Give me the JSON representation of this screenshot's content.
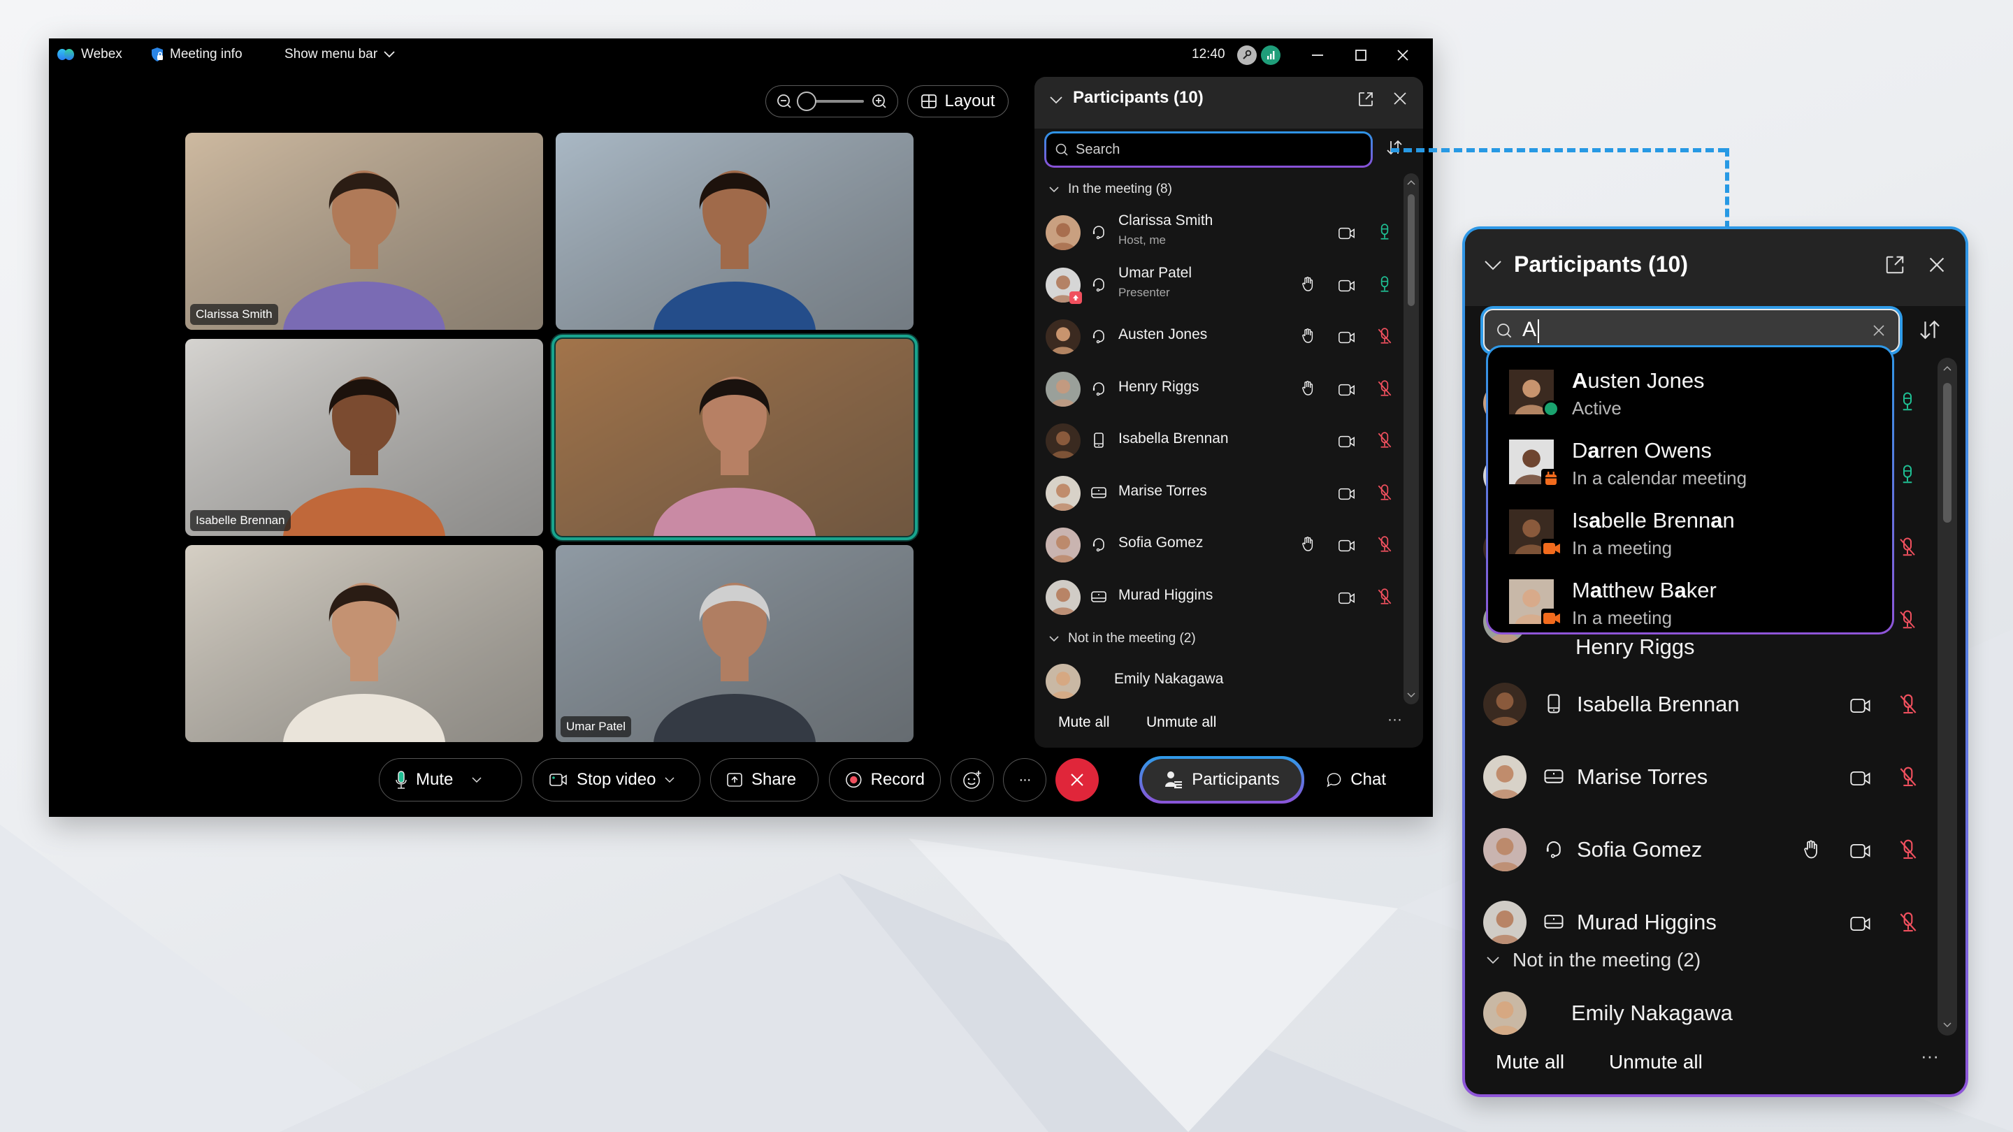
{
  "titlebar": {
    "app_name": "Webex",
    "meeting_info": "Meeting info",
    "show_menu_bar": "Show menu bar",
    "time": "12:40",
    "icons": [
      "webex-logo-icon",
      "shield-lock-icon",
      "chevron-down-icon",
      "key-icon",
      "signal-icon",
      "minimize-icon",
      "maximize-icon",
      "close-icon"
    ]
  },
  "view_controls": {
    "zoom_level": 0,
    "layout_label": "Layout"
  },
  "video_tiles": [
    {
      "name": "Clarissa Smith",
      "show_label": true,
      "active": false,
      "bg": "#cdb9a0",
      "shirt": "#7a6bb4",
      "skin": "#b07a58",
      "hair": "#2b1d14"
    },
    {
      "name": "",
      "show_label": false,
      "active": false,
      "bg": "#a9b8c4",
      "shirt": "#244d8a",
      "skin": "#a06a4a",
      "hair": "#1d120c"
    },
    {
      "name": "Isabelle Brennan",
      "show_label": true,
      "active": false,
      "bg": "#d5d3d0",
      "shirt": "#c0683a",
      "skin": "#7b4b30",
      "hair": "#1c120c"
    },
    {
      "name": "",
      "show_label": false,
      "active": true,
      "bg": "#a3744a",
      "shirt": "#c98aa4",
      "skin": "#b78064",
      "hair": "#1a120e"
    },
    {
      "name": "",
      "show_label": false,
      "active": false,
      "bg": "#d6cfc4",
      "shirt": "#eae4da",
      "skin": "#c49272",
      "hair": "#2a1c14"
    },
    {
      "name": "Umar Patel",
      "show_label": true,
      "active": false,
      "bg": "#8f9aa4",
      "shirt": "#343a44",
      "skin": "#b07e62",
      "hair": "#cfcfcf"
    }
  ],
  "toolbar": {
    "mute": "Mute",
    "stop_video": "Stop video",
    "share": "Share",
    "record": "Record",
    "reactions_icon": "emoji-add-icon",
    "more": "···",
    "end_icon": "close-icon",
    "participants": "Participants",
    "chat": "Chat"
  },
  "participants_panel": {
    "title": "Participants (10)",
    "search_placeholder": "Search",
    "in_meeting_header": "In the meeting (8)",
    "not_in_meeting_header": "Not in the meeting (2)",
    "in_meeting": [
      {
        "name": "Clarissa Smith",
        "sub": "Host, me",
        "device": "headset",
        "hand": false,
        "mic": "on",
        "presenter": false,
        "avatar_bg": "#c9a080",
        "avatar_skin": "#a86e4e"
      },
      {
        "name": "Umar Patel",
        "sub": "Presenter",
        "device": "headset",
        "hand": true,
        "mic": "on",
        "presenter": true,
        "avatar_bg": "#d6d6d6",
        "avatar_skin": "#b48266"
      },
      {
        "name": "Austen Jones",
        "sub": "",
        "device": "headset",
        "hand": true,
        "mic": "muted",
        "presenter": false,
        "avatar_bg": "#3b2a20",
        "avatar_skin": "#c8946e"
      },
      {
        "name": "Henry Riggs",
        "sub": "",
        "device": "headset",
        "hand": true,
        "mic": "muted",
        "presenter": false,
        "avatar_bg": "#9aa09a",
        "avatar_skin": "#c29a80"
      },
      {
        "name": "Isabella Brennan",
        "sub": "",
        "device": "phone",
        "hand": false,
        "mic": "muted",
        "presenter": false,
        "avatar_bg": "#3a2a20",
        "avatar_skin": "#8a5a3c"
      },
      {
        "name": "Marise Torres",
        "sub": "",
        "device": "room",
        "hand": false,
        "mic": "muted",
        "presenter": false,
        "avatar_bg": "#d8d2c8",
        "avatar_skin": "#c08c6c"
      },
      {
        "name": "Sofia Gomez",
        "sub": "",
        "device": "headset",
        "hand": true,
        "mic": "muted",
        "presenter": false,
        "avatar_bg": "#c9b4b0",
        "avatar_skin": "#bc8a6c"
      },
      {
        "name": "Murad Higgins",
        "sub": "",
        "device": "room",
        "hand": false,
        "mic": "muted",
        "presenter": false,
        "avatar_bg": "#d0ccc6",
        "avatar_skin": "#b88466"
      }
    ],
    "not_in_meeting": [
      {
        "name": "Emily Nakagawa",
        "avatar_bg": "#c9b8a4",
        "avatar_skin": "#d6a882"
      }
    ],
    "mute_all": "Mute all",
    "unmute_all": "Unmute all",
    "more": "···"
  },
  "callout_panel": {
    "title": "Participants (10)",
    "search_value": "A",
    "suggestions": [
      {
        "parts": [
          [
            "A",
            true
          ],
          [
            "usten Jones",
            false
          ]
        ],
        "status": "Active",
        "status_type": "active",
        "avatar_bg": "#3b2a20",
        "avatar_skin": "#c8946e"
      },
      {
        "parts": [
          [
            "D",
            false
          ],
          [
            "a",
            true
          ],
          [
            "rren Owens",
            false
          ]
        ],
        "status": "In a calendar meeting",
        "status_type": "calendar",
        "avatar_bg": "#e0e0e0",
        "avatar_skin": "#6e4530"
      },
      {
        "parts": [
          [
            "Is",
            false
          ],
          [
            "a",
            true
          ],
          [
            "belle Brenn",
            false
          ],
          [
            "a",
            true
          ],
          [
            "n",
            false
          ]
        ],
        "status": "In a meeting",
        "status_type": "meeting",
        "avatar_bg": "#3a2a20",
        "avatar_skin": "#8a5a3c"
      },
      {
        "parts": [
          [
            "M",
            false
          ],
          [
            "a",
            true
          ],
          [
            "tthew B",
            false
          ],
          [
            "a",
            true
          ],
          [
            "ker",
            false
          ]
        ],
        "status": "In a meeting",
        "status_type": "meeting",
        "avatar_bg": "#c8b8a8",
        "avatar_skin": "#d8aa8a"
      }
    ],
    "partially_hidden_row": "Henry Riggs",
    "visible_rows": [
      {
        "name": "Isabella Brennan",
        "device": "phone",
        "hand": false,
        "mic": "muted",
        "avatar_bg": "#3a2a20",
        "avatar_skin": "#8a5a3c"
      },
      {
        "name": "Marise Torres",
        "device": "room",
        "hand": false,
        "mic": "muted",
        "avatar_bg": "#d8d2c8",
        "avatar_skin": "#c08c6c"
      },
      {
        "name": "Sofia Gomez",
        "device": "headset",
        "hand": true,
        "mic": "muted",
        "avatar_bg": "#c9b4b0",
        "avatar_skin": "#bc8a6c"
      },
      {
        "name": "Murad Higgins",
        "device": "room",
        "hand": false,
        "mic": "muted",
        "avatar_bg": "#d0ccc6",
        "avatar_skin": "#b88466"
      }
    ],
    "not_in_meeting_header": "Not in the meeting (2)",
    "not_in_meeting": [
      {
        "name": "Emily Nakagawa",
        "avatar_bg": "#c9b8a4",
        "avatar_skin": "#d6a882"
      }
    ],
    "mute_all": "Mute all",
    "unmute_all": "Unmute all",
    "more": "···"
  },
  "colors": {
    "accent_blue": "#2799e4",
    "accent_purple": "#8a4fd6",
    "mic_on_green": "#1fbf93",
    "mic_muted_red": "#f0505e",
    "end_call_red": "#e0263a",
    "active_tile_teal": "#19a48d",
    "status_active": "#1aa36f",
    "status_meeting": "#f26b1d"
  }
}
